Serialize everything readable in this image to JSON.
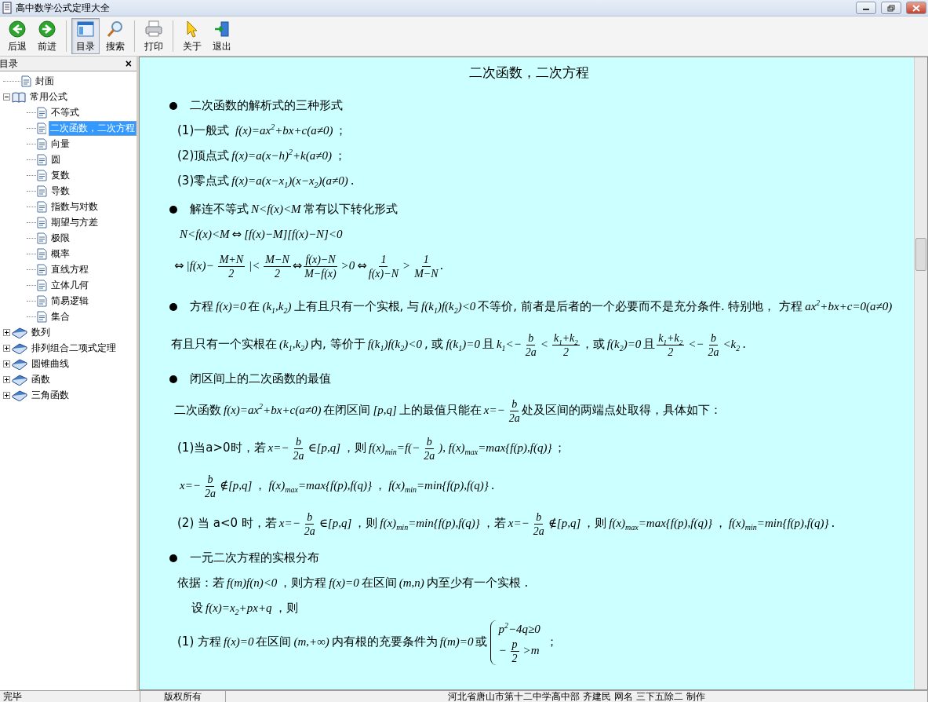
{
  "window": {
    "title": "高中数学公式定理大全"
  },
  "toolbar": [
    {
      "label": "后退",
      "kind": "back",
      "selected": false
    },
    {
      "label": "前进",
      "kind": "forward",
      "selected": false
    },
    {
      "label": "目录",
      "kind": "contents",
      "selected": true
    },
    {
      "label": "搜索",
      "kind": "search",
      "selected": false
    },
    {
      "label": "打印",
      "kind": "print",
      "selected": false
    },
    {
      "label": "关于",
      "kind": "about",
      "selected": false
    },
    {
      "label": "退出",
      "kind": "exit",
      "selected": false
    }
  ],
  "sidebar": {
    "title": "目录",
    "close": "×",
    "items": [
      {
        "label": "封面",
        "selected": false
      },
      {
        "label": "常用公式",
        "expanded": true,
        "selected": false,
        "children": [
          {
            "label": "不等式",
            "selected": false
          },
          {
            "label": "二次函数，二次方程",
            "selected": true
          },
          {
            "label": "向量",
            "selected": false
          },
          {
            "label": "圆",
            "selected": false
          },
          {
            "label": "复数",
            "selected": false
          },
          {
            "label": "导数",
            "selected": false
          },
          {
            "label": "指数与对数",
            "selected": false
          },
          {
            "label": "期望与方差",
            "selected": false
          },
          {
            "label": "极限",
            "selected": false
          },
          {
            "label": "概率",
            "selected": false
          },
          {
            "label": "直线方程",
            "selected": false
          },
          {
            "label": "立体几何",
            "selected": false
          },
          {
            "label": "简易逻辑",
            "selected": false
          },
          {
            "label": "集合",
            "selected": false
          }
        ]
      },
      {
        "label": "数列",
        "expanded": false,
        "selected": false
      },
      {
        "label": "排列组合二项式定理",
        "expanded": false,
        "selected": false
      },
      {
        "label": "圆锥曲线",
        "expanded": false,
        "selected": false
      },
      {
        "label": "函数",
        "expanded": false,
        "selected": false
      },
      {
        "label": "三角函数",
        "expanded": false,
        "selected": false
      }
    ]
  },
  "document": {
    "title": "二次函数，二次方程",
    "lines": [
      {
        "kind": "bullet",
        "segs": [
          {
            "kind": "text",
            "t": "二次函数的解析式的三种形式"
          }
        ]
      },
      {
        "kind": "sub",
        "segs": [
          {
            "kind": "text",
            "t": "(1)一般式 "
          },
          {
            "kind": "math",
            "t": "f(x)=ax$^{2}$+bx+c(a≠0)"
          },
          {
            "kind": "text",
            "t": "；"
          }
        ]
      },
      {
        "kind": "sub",
        "segs": [
          {
            "kind": "text",
            "t": "(2)顶点式"
          },
          {
            "kind": "math",
            "t": "f(x)=a(x−h)$^{2}$+k(a≠0)"
          },
          {
            "kind": "text",
            "t": "；"
          }
        ]
      },
      {
        "kind": "sub",
        "segs": [
          {
            "kind": "text",
            "t": "(3)零点式"
          },
          {
            "kind": "math",
            "t": "f(x)=a(x−x$_{1}$)(x−x$_{2}$)(a≠0)"
          },
          {
            "kind": "text",
            "t": "."
          }
        ]
      },
      {
        "kind": "bullet",
        "segs": [
          {
            "kind": "text",
            "t": "解连不等式"
          },
          {
            "kind": "math",
            "t": "N<f(x)<M"
          },
          {
            "kind": "text",
            "t": "常有以下转化形式"
          }
        ]
      },
      {
        "kind": "sub",
        "segs": [
          {
            "kind": "math",
            "t": "N<f(x)<M"
          },
          {
            "kind": "text",
            "t": "⇔"
          },
          {
            "kind": "math",
            "t": "[f(x)−M][f(x)−N]<0"
          }
        ]
      },
      {
        "kind": "plain",
        "segs": [
          {
            "kind": "text",
            "t": "⇔"
          },
          {
            "kind": "math",
            "t": "|f(x)−"
          },
          {
            "kind": "frac",
            "num": "M+N",
            "den": "2"
          },
          {
            "kind": "math",
            "t": "|<"
          },
          {
            "kind": "frac",
            "num": "M−N",
            "den": "2"
          },
          {
            "kind": "text",
            "t": "⇔"
          },
          {
            "kind": "frac",
            "num": "f(x)−N",
            "den": "M−f(x)"
          },
          {
            "kind": "math",
            "t": ">0"
          },
          {
            "kind": "text",
            "t": "⇔"
          },
          {
            "kind": "frac",
            "num": "1",
            "den": "f(x)−N"
          },
          {
            "kind": "math",
            "t": ">"
          },
          {
            "kind": "frac",
            "num": "1",
            "den": "M−N"
          },
          {
            "kind": "text",
            "t": "."
          }
        ]
      },
      {
        "kind": "bullet",
        "segs": [
          {
            "kind": "text",
            "t": "方程"
          },
          {
            "kind": "math",
            "t": "f(x)=0"
          },
          {
            "kind": "text",
            "t": "在"
          },
          {
            "kind": "math",
            "t": "(k$_{1}$,k$_{2}$)"
          },
          {
            "kind": "text",
            "t": "上有且只有一个实根, 与"
          },
          {
            "kind": "math",
            "t": "f(k$_{1}$)f(k$_{2}$)<0"
          },
          {
            "kind": "text",
            "t": "不等价, 前者是后者的一个必要而不是充分条件. 特别地， 方程"
          },
          {
            "kind": "math",
            "t": "ax$^{2}$+bx+c=0(a≠0)"
          },
          {
            "kind": "text",
            "t": "有且只有一个实根在"
          },
          {
            "kind": "math",
            "t": "(k$_{1}$,k$_{2}$)"
          },
          {
            "kind": "text",
            "t": "内, 等价于"
          },
          {
            "kind": "math",
            "t": "f(k$_{1}$)f(k$_{2}$)<0"
          },
          {
            "kind": "text",
            "t": ", 或"
          },
          {
            "kind": "math",
            "t": "f(k$_{1}$)=0"
          },
          {
            "kind": "text",
            "t": "且"
          },
          {
            "kind": "math",
            "t": "k$_{1}$<−"
          },
          {
            "kind": "frac",
            "num": "b",
            "den": "2a"
          },
          {
            "kind": "math",
            "t": "<"
          },
          {
            "kind": "frac",
            "num": "k$_{1}$+k$_{2}$",
            "den": "2"
          },
          {
            "kind": "text",
            "t": "，或"
          },
          {
            "kind": "math",
            "t": "f(k$_{2}$)=0"
          },
          {
            "kind": "text",
            "t": "且"
          },
          {
            "kind": "frac",
            "num": "k$_{1}$+k$_{2}$",
            "den": "2"
          },
          {
            "kind": "math",
            "t": "<−"
          },
          {
            "kind": "frac",
            "num": "b",
            "den": "2a"
          },
          {
            "kind": "math",
            "t": "<k$_{2}$"
          },
          {
            "kind": "text",
            "t": "."
          }
        ]
      },
      {
        "kind": "bullet",
        "segs": [
          {
            "kind": "text",
            "t": "闭区间上的二次函数的最值"
          }
        ]
      },
      {
        "kind": "plain",
        "segs": [
          {
            "kind": "text",
            "t": "二次函数"
          },
          {
            "kind": "math",
            "t": "f(x)=ax$^{2}$+bx+c(a≠0)"
          },
          {
            "kind": "text",
            "t": "在闭区间"
          },
          {
            "kind": "math",
            "t": "[p,q]"
          },
          {
            "kind": "text",
            "t": "上的最值只能在"
          },
          {
            "kind": "math",
            "t": "x=−"
          },
          {
            "kind": "frac",
            "num": "b",
            "den": "2a"
          },
          {
            "kind": "text",
            "t": "处及区间的两端点处取得，具体如下："
          }
        ]
      },
      {
        "kind": "sub",
        "segs": [
          {
            "kind": "text",
            "t": "(1)当a>0时，若"
          },
          {
            "kind": "math",
            "t": "x=−"
          },
          {
            "kind": "frac",
            "num": "b",
            "den": "2a"
          },
          {
            "kind": "math",
            "t": "∈[p,q]"
          },
          {
            "kind": "text",
            "t": "，则"
          },
          {
            "kind": "math",
            "t": "f(x)$_{min}$=f(−"
          },
          {
            "kind": "frac",
            "num": "b",
            "den": "2a"
          },
          {
            "kind": "math",
            "t": "), f(x)$_{max}$=max{f(p),f(q)}"
          },
          {
            "kind": "text",
            "t": "；"
          }
        ]
      },
      {
        "kind": "sub",
        "segs": [
          {
            "kind": "math",
            "t": "x=−"
          },
          {
            "kind": "frac",
            "num": "b",
            "den": "2a"
          },
          {
            "kind": "math",
            "t": "∉[p,q]"
          },
          {
            "kind": "text",
            "t": "，"
          },
          {
            "kind": "math",
            "t": "f(x)$_{max}$=max{f(p),f(q)}"
          },
          {
            "kind": "text",
            "t": "，"
          },
          {
            "kind": "math",
            "t": "f(x)$_{min}$=min{f(p),f(q)}"
          },
          {
            "kind": "text",
            "t": "."
          }
        ]
      },
      {
        "kind": "para",
        "segs": [
          {
            "kind": "text",
            "t": "(2) 当 a<0 时，若"
          },
          {
            "kind": "math",
            "t": "x=−"
          },
          {
            "kind": "frac",
            "num": "b",
            "den": "2a"
          },
          {
            "kind": "math",
            "t": "∈[p,q]"
          },
          {
            "kind": "text",
            "t": "，则"
          },
          {
            "kind": "math",
            "t": "f(x)$_{min}$=min{f(p),f(q)}"
          },
          {
            "kind": "text",
            "t": "，若"
          },
          {
            "kind": "math",
            "t": "x=−"
          },
          {
            "kind": "frac",
            "num": "b",
            "den": "2a"
          },
          {
            "kind": "math",
            "t": "∉[p,q]"
          },
          {
            "kind": "text",
            "t": "，则"
          },
          {
            "kind": "math",
            "t": "f(x)$_{max}$=max{f(p),f(q)}"
          },
          {
            "kind": "text",
            "t": "，"
          },
          {
            "kind": "math",
            "t": "f(x)$_{min}$=min{f(p),f(q)}"
          },
          {
            "kind": "text",
            "t": "."
          }
        ]
      },
      {
        "kind": "bullet",
        "segs": [
          {
            "kind": "text",
            "t": "一元二次方程的实根分布"
          }
        ]
      },
      {
        "kind": "sub",
        "segs": [
          {
            "kind": "text",
            "t": "依据：若"
          },
          {
            "kind": "math",
            "t": "f(m)f(n)<0"
          },
          {
            "kind": "text",
            "t": "，则方程"
          },
          {
            "kind": "math",
            "t": "f(x)=0"
          },
          {
            "kind": "text",
            "t": "在区间"
          },
          {
            "kind": "math",
            "t": "(m,n)"
          },
          {
            "kind": "text",
            "t": "内至少有一个实根 ."
          }
        ]
      },
      {
        "kind": "sub2",
        "segs": [
          {
            "kind": "text",
            "t": "设"
          },
          {
            "kind": "math",
            "t": "f(x)=x$_{2}$+px+q"
          },
          {
            "kind": "text",
            "t": "，则"
          }
        ]
      },
      {
        "kind": "sub",
        "segs": [
          {
            "kind": "text",
            "t": "(1) 方程"
          },
          {
            "kind": "math",
            "t": "f(x)=0"
          },
          {
            "kind": "text",
            "t": "在区间"
          },
          {
            "kind": "math",
            "t": "(m,+∞)"
          },
          {
            "kind": "text",
            "t": "内有根的充要条件为"
          },
          {
            "kind": "math",
            "t": "f(m)=0"
          },
          {
            "kind": "text",
            "t": "或"
          },
          {
            "kind": "cases",
            "rows": [
              [
                {
                  "kind": "math",
                  "t": "p$^{2}$−4q≥0"
                }
              ],
              [
                {
                  "kind": "math",
                  "t": "−"
                },
                {
                  "kind": "frac",
                  "num": "p",
                  "den": "2"
                },
                {
                  "kind": "math",
                  "t": ">m"
                }
              ]
            ]
          },
          {
            "kind": "text",
            "t": "；"
          }
        ]
      }
    ]
  },
  "status_bar": [
    "完毕",
    "版权所有",
    "河北省唐山市第十二中学高中部 齐建民 网名 三下五除二 制作"
  ]
}
